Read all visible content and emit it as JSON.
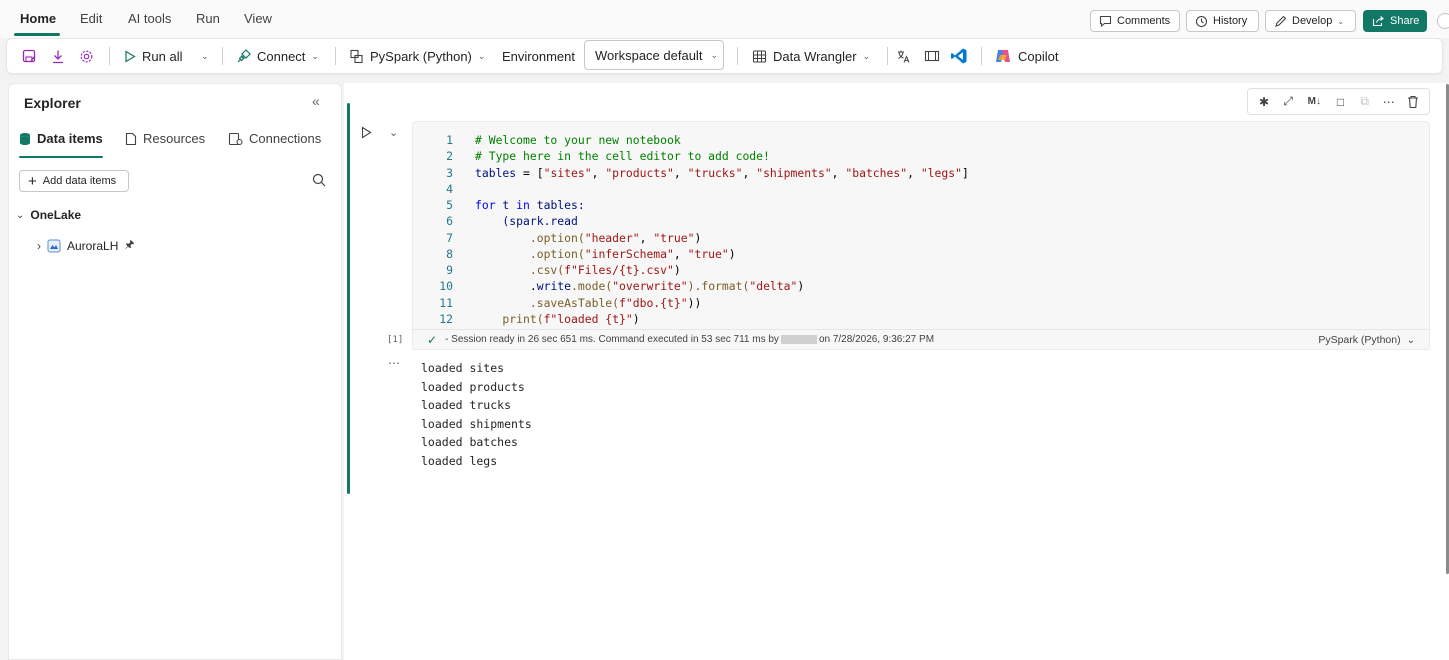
{
  "menu": {
    "tabs": [
      "Home",
      "Edit",
      "AI tools",
      "Run",
      "View"
    ],
    "buttons": {
      "comments": "Comments",
      "history": "History",
      "develop": "Develop",
      "share": "Share"
    }
  },
  "ribbon": {
    "run_all": "Run all",
    "connect": "Connect",
    "language": "PySpark (Python)",
    "environment_label": "Environment",
    "workspace": "Workspace default",
    "data_wrangler": "Data Wrangler",
    "copilot": "Copilot"
  },
  "explorer": {
    "title": "Explorer",
    "tabs": [
      "Data items",
      "Resources",
      "Connections"
    ],
    "add_button": "Add data items",
    "tree": {
      "root": "OneLake",
      "child": "AuroraLH"
    }
  },
  "cell": {
    "exec_count": "[1]",
    "status_prefix": "- Session ready in 26 sec 651 ms. Command executed in 53 sec 711 ms by",
    "status_suffix": "on 7/28/2026, 9:36:27 PM",
    "language": "PySpark (Python)",
    "toolbar_md": "M↓",
    "line_numbers": [
      "1",
      "2",
      "3",
      "4",
      "5",
      "6",
      "7",
      "8",
      "9",
      "10",
      "11",
      "12"
    ],
    "code": {
      "l1": "# Welcome to your new notebook",
      "l2": "# Type here in the cell editor to add code!",
      "l3_var": "tables",
      "l3_eq": " = [",
      "l3_s1": "\"sites\"",
      "l3_s2": "\"products\"",
      "l3_s3": "\"trucks\"",
      "l3_s4": "\"shipments\"",
      "l3_s5": "\"batches\"",
      "l3_s6": "\"legs\"",
      "l5_for": "for",
      "l5_t": " t ",
      "l5_in": "in",
      "l5_tables": " tables:",
      "l6": "    (spark.read",
      "l7_a": "        .option(",
      "l7_b": "\"header\"",
      "l7_c": ", ",
      "l7_d": "\"true\"",
      "l7_e": ")",
      "l8_a": "        .option(",
      "l8_b": "\"inferSchema\"",
      "l8_c": ", ",
      "l8_d": "\"true\"",
      "l8_e": ")",
      "l9_a": "        .csv(",
      "l9_b": "f\"Files/{t}.csv\"",
      "l9_c": ")",
      "l10_a": "        .",
      "l10_b": "write",
      "l10_c": ".mode(",
      "l10_d": "\"overwrite\"",
      "l10_e": ").format(",
      "l10_f": "\"delta\"",
      "l10_g": ")",
      "l11_a": "        .saveAsTable(",
      "l11_b": "f\"dbo.{t}\"",
      "l11_c": "))",
      "l12_a": "    print(",
      "l12_b": "f\"loaded {t}\"",
      "l12_c": ")"
    },
    "output": [
      "loaded sites",
      "loaded products",
      "loaded trucks",
      "loaded shipments",
      "loaded batches",
      "loaded legs"
    ]
  },
  "colors": {
    "accent": "#117865",
    "copilot": "#e8508a",
    "vscode": "#0078d4",
    "purple_icon": "#9b2bb4"
  }
}
